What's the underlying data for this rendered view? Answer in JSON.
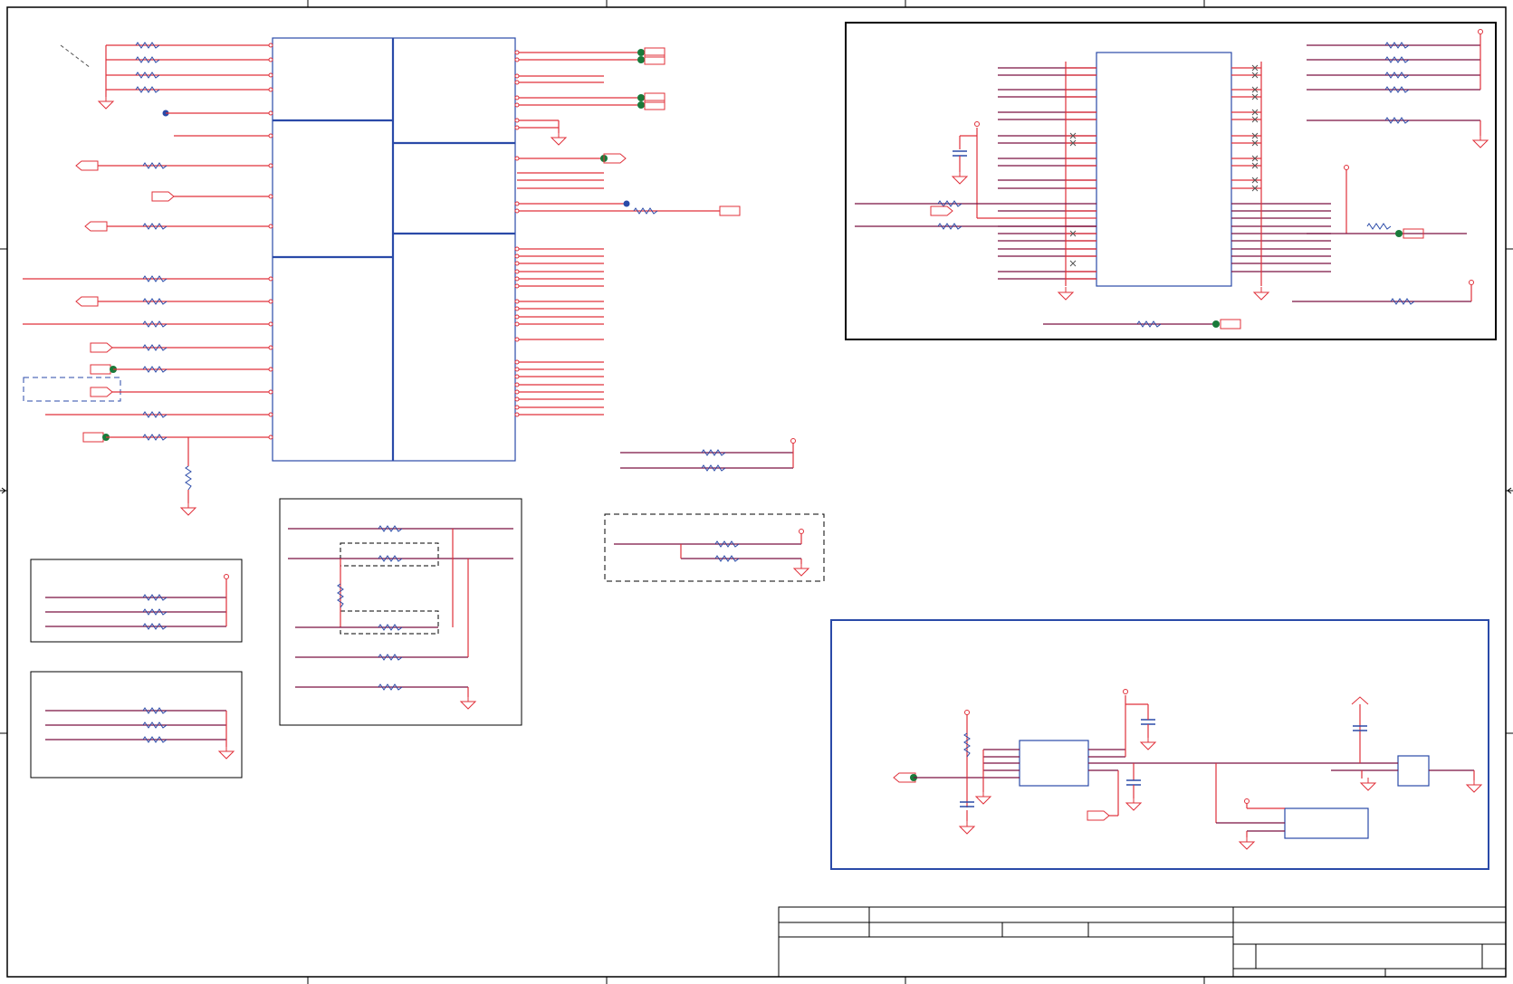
{
  "sheet": {
    "title_block": {
      "cells": []
    }
  },
  "colors": {
    "wire": "#e0303a",
    "net": "#7a1040",
    "block": "#2a4aa8",
    "junction": "#1a7a3a",
    "frame": "#000000"
  },
  "icons": [
    "ground-symbol",
    "power-symbol",
    "resistor-symbol",
    "capacitor-symbol",
    "off-page-connector",
    "no-connect-marker",
    "junction-dot"
  ]
}
